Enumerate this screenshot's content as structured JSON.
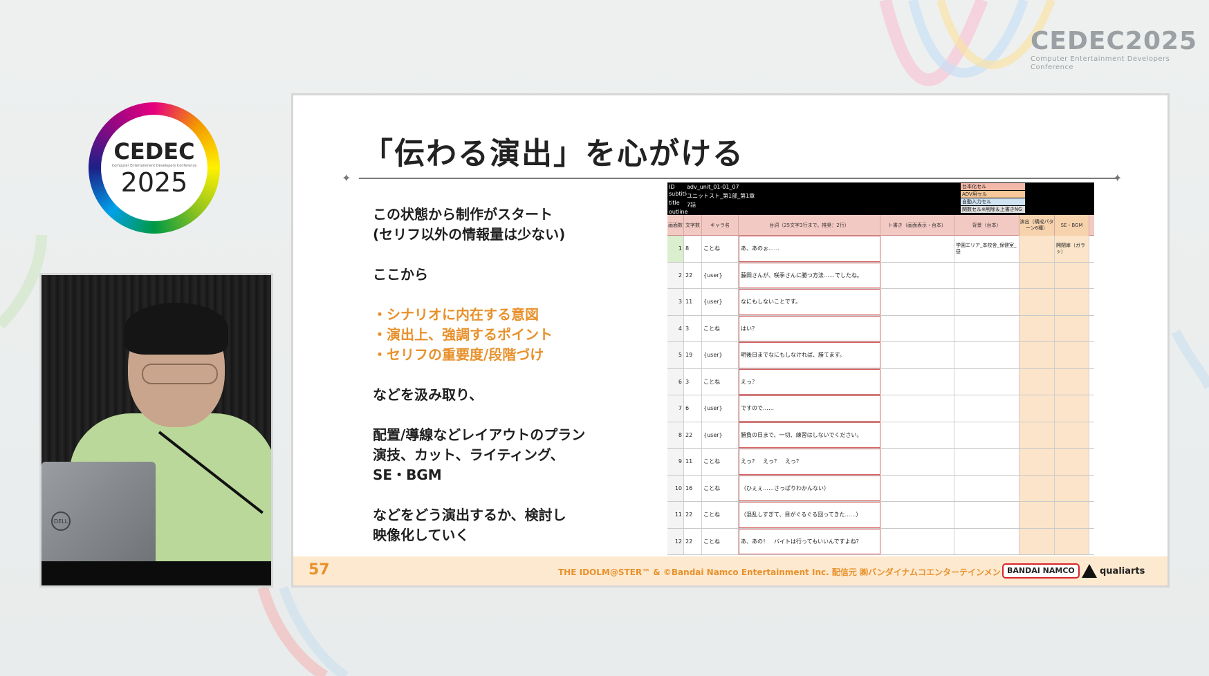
{
  "conference_logo_top_right": {
    "brand": "CEDEC2025",
    "subtitle": "Computer Entertainment Developers Conference"
  },
  "conference_logo_circle": {
    "brand": "CEDEC",
    "subtitle": "Computer Entertainment Developers Conference",
    "year": "2025"
  },
  "speaker_video": {
    "laptop_brand": "DELL"
  },
  "slide": {
    "title": "「伝わる演出」を心がける",
    "body": {
      "line1": "この状態から制作がスタート",
      "line2": "(セリフ以外の情報量は少ない)",
      "line3": "ここから",
      "bullet1": "・シナリオに内在する意図",
      "bullet2": "・演出上、強調するポイント",
      "bullet3": "・セリフの重要度/段階づけ",
      "line4": "などを汲み取り、",
      "line5": "配置/導線などレイアウトのプラン",
      "line6": "演技、カット、ライティング、",
      "line7": "SE・BGM",
      "line8": "などをどう演出するか、検討し",
      "line9": "映像化していく"
    },
    "sheet": {
      "meta": {
        "id_label": "ID",
        "id_value": "adv_unit_01-01_07",
        "subtitle_label": "subtitle",
        "subtitle_value": "ユニットスト_第1部_第1章",
        "title_label": "title",
        "title_value": "7話",
        "outline_label": "outline"
      },
      "legend": [
        {
          "label": "台本化セル",
          "color": "#f3b8a8"
        },
        {
          "label": "ADV用セル",
          "color": "#f6c89a"
        },
        {
          "label": "自動入力セル",
          "color": "#cfe3f3"
        },
        {
          "label": "関数セル※削除＆上書きNG",
          "color": "#dcdcdc"
        }
      ],
      "headers": {
        "h1": "画面数",
        "h2": "文字数",
        "h3": "キャラ名",
        "h4": "台詞（25文字3行まで。推奨：2行）",
        "h5": "ト書き（画面表示・台本）",
        "h6": "背景（台本）",
        "h7": "演出（構成パターン6種）",
        "h8": "SE・BGM"
      },
      "rows": [
        {
          "n": "1",
          "count": "8",
          "chara": "ことね",
          "line": "あ、あのぉ……",
          "bg": "学園エリア_本校舎_保健室_昼",
          "se": "開閉扉（ガラッ）"
        },
        {
          "n": "2",
          "count": "22",
          "chara": "{user}",
          "line": "藤田さんが、咲季さんに勝つ方法……でしたね。",
          "bg": "",
          "se": ""
        },
        {
          "n": "3",
          "count": "11",
          "chara": "{user}",
          "line": "なにもしないことです。",
          "bg": "",
          "se": ""
        },
        {
          "n": "4",
          "count": "3",
          "chara": "ことね",
          "line": "はい？",
          "bg": "",
          "se": ""
        },
        {
          "n": "5",
          "count": "19",
          "chara": "{user}",
          "line": "明後日までなにもしなければ、勝てます。",
          "bg": "",
          "se": ""
        },
        {
          "n": "6",
          "count": "3",
          "chara": "ことね",
          "line": "えっ？",
          "bg": "",
          "se": ""
        },
        {
          "n": "7",
          "count": "6",
          "chara": "{user}",
          "line": "ですので……",
          "bg": "",
          "se": ""
        },
        {
          "n": "8",
          "count": "22",
          "chara": "{user}",
          "line": "勝負の日まで、一切、練習はしないでください。",
          "bg": "",
          "se": ""
        },
        {
          "n": "9",
          "count": "11",
          "chara": "ことね",
          "line": "えっ？　えっ？　えっ？",
          "bg": "",
          "se": ""
        },
        {
          "n": "10",
          "count": "16",
          "chara": "ことね",
          "line": "（ひぇぇ……さっぱりわかんない）",
          "bg": "",
          "se": ""
        },
        {
          "n": "11",
          "count": "22",
          "chara": "ことね",
          "line": "（混乱しすぎて、目がぐるぐる回ってきた……）",
          "bg": "",
          "se": ""
        },
        {
          "n": "12",
          "count": "22",
          "chara": "ことね",
          "line": "あ、あの！　バイトは行ってもいいんですよね？",
          "bg": "",
          "se": ""
        }
      ]
    },
    "footer": {
      "page": "57",
      "copyright": "THE IDOLM@STER™ & ©Bandai Namco Entertainment Inc.  配信元 ㈱バンダイナムコエンターテインメント",
      "publisher_logo": "BANDAI NAMCO",
      "developer_logo": "qualiarts"
    }
  }
}
